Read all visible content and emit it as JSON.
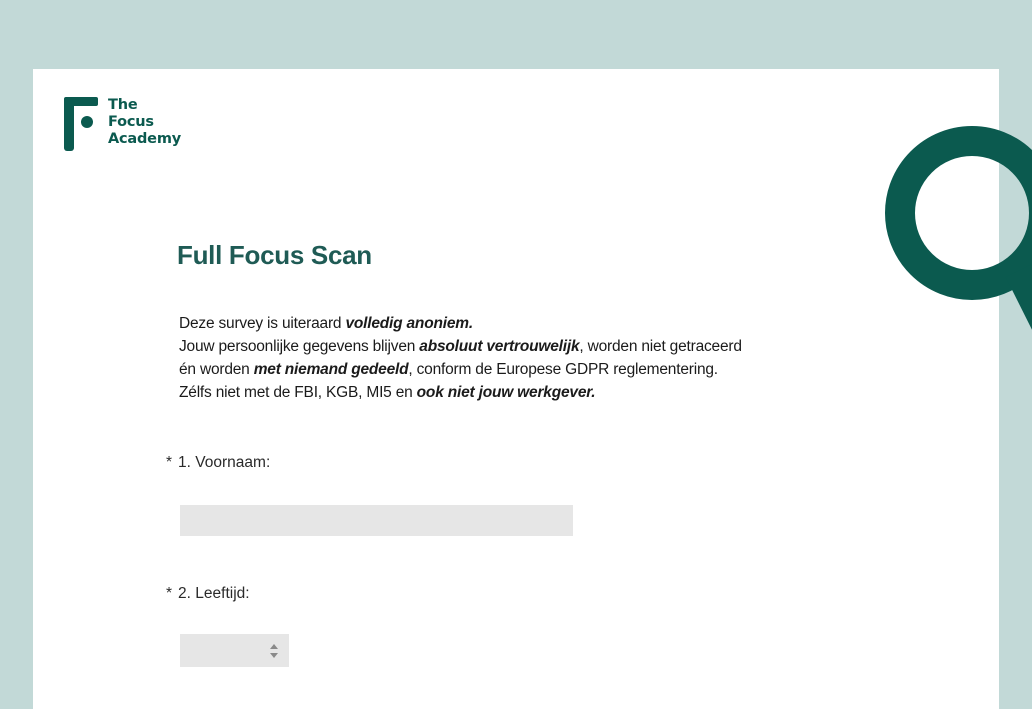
{
  "brand": {
    "line1": "The",
    "line2": "Focus",
    "line3": "Academy",
    "color": "#0b5a4f"
  },
  "colors": {
    "background": "#c2d9d7",
    "accent": "#0b5a4f",
    "input_bg": "#e6e6e6"
  },
  "survey": {
    "title": "Full Focus Scan",
    "intro": {
      "l1_a": "Deze survey is uiteraard ",
      "l1_b": "volledig anoniem.",
      "l2_a": "Jouw persoonlijke gegevens blijven ",
      "l2_b": "absoluut vertrouwelijk",
      "l2_c": ", worden niet getraceerd",
      "l3_a": "én worden ",
      "l3_b": "met niemand gedeeld",
      "l3_c": ", conform de Europese GDPR reglementering.",
      "l4_a": "Zélfs niet met de FBI, KGB, MI5 en ",
      "l4_b": "ook niet jouw werkgever."
    }
  },
  "questions": [
    {
      "required_mark": "*",
      "label": "1. Voornaam:",
      "value": "",
      "placeholder": ""
    },
    {
      "required_mark": "*",
      "label": "2. Leeftijd:",
      "selected": ""
    }
  ],
  "icons": {
    "logo": "focus-academy-logo-icon",
    "decor": "magnifier-icon",
    "select_arrows": "updown-arrows-icon"
  }
}
